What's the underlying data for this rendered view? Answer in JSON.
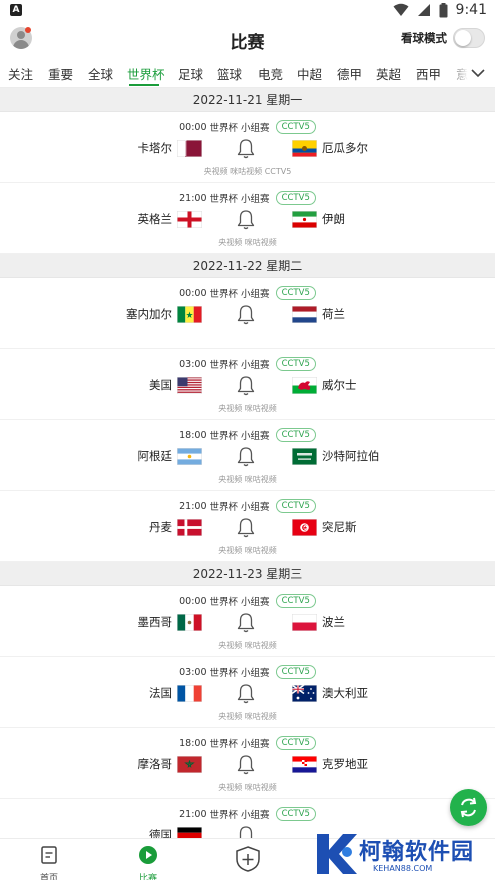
{
  "status": {
    "app_badge": "A",
    "time": "9:41"
  },
  "header": {
    "title": "比赛",
    "mode_label": "看球模式"
  },
  "tabs": [
    "关注",
    "重要",
    "全球",
    "世界杯",
    "足球",
    "篮球",
    "电竞",
    "中超",
    "德甲",
    "英超",
    "西甲",
    "意"
  ],
  "active_tab": "世界杯",
  "days": [
    {
      "date": "2022-11-21 星期一",
      "matches": [
        {
          "time": "00:00",
          "league": "世界杯 小组赛",
          "channel": "CCTV5",
          "home": "卡塔尔",
          "home_flag": "qatar-flag",
          "away": "厄瓜多尔",
          "away_flag": "ecuador-flag",
          "broadcast": "央视频 咪咕视频 CCTV5"
        },
        {
          "time": "21:00",
          "league": "世界杯 小组赛",
          "channel": "CCTV5",
          "home": "英格兰",
          "home_flag": "england-flag",
          "away": "伊朗",
          "away_flag": "iran-flag",
          "broadcast": "央视频 咪咕视频"
        }
      ]
    },
    {
      "date": "2022-11-22 星期二",
      "matches": [
        {
          "time": "00:00",
          "league": "世界杯 小组赛",
          "channel": "CCTV5",
          "home": "塞内加尔",
          "home_flag": "senegal-flag",
          "away": "荷兰",
          "away_flag": "netherlands-flag",
          "broadcast": ""
        },
        {
          "time": "03:00",
          "league": "世界杯 小组赛",
          "channel": "CCTV5",
          "home": "美国",
          "home_flag": "usa-flag",
          "away": "威尔士",
          "away_flag": "wales-flag",
          "broadcast": "央视频 咪咕视频"
        },
        {
          "time": "18:00",
          "league": "世界杯 小组赛",
          "channel": "CCTV5",
          "home": "阿根廷",
          "home_flag": "argentina-flag",
          "away": "沙特阿拉伯",
          "away_flag": "saudi-flag",
          "broadcast": "央视频 咪咕视频"
        },
        {
          "time": "21:00",
          "league": "世界杯 小组赛",
          "channel": "CCTV5",
          "home": "丹麦",
          "home_flag": "denmark-flag",
          "away": "突尼斯",
          "away_flag": "tunisia-flag",
          "broadcast": "央视频 咪咕视频"
        }
      ]
    },
    {
      "date": "2022-11-23 星期三",
      "matches": [
        {
          "time": "00:00",
          "league": "世界杯 小组赛",
          "channel": "CCTV5",
          "home": "墨西哥",
          "home_flag": "mexico-flag",
          "away": "波兰",
          "away_flag": "poland-flag",
          "broadcast": "央视频 咪咕视频"
        },
        {
          "time": "03:00",
          "league": "世界杯 小组赛",
          "channel": "CCTV5",
          "home": "法国",
          "home_flag": "france-flag",
          "away": "澳大利亚",
          "away_flag": "australia-flag",
          "broadcast": "央视频 咪咕视频"
        },
        {
          "time": "18:00",
          "league": "世界杯 小组赛",
          "channel": "CCTV5",
          "home": "摩洛哥",
          "home_flag": "morocco-flag",
          "away": "克罗地亚",
          "away_flag": "croatia-flag",
          "broadcast": "央视频 咪咕视频"
        },
        {
          "time": "21:00",
          "league": "世界杯 小组赛",
          "channel": "CCTV5",
          "home": "德国",
          "home_flag": "germany-flag",
          "away": "",
          "away_flag": "",
          "broadcast": ""
        }
      ]
    }
  ],
  "bottom_nav": {
    "home_label": "首页",
    "match_label": "比赛"
  },
  "watermark": {
    "text": "柯翰软件园",
    "url": "KEHAN88.COM"
  },
  "colors": {
    "accent": "#1a9c3a",
    "channel_border": "#7cc98f",
    "watermark": "#1d4fb3"
  }
}
